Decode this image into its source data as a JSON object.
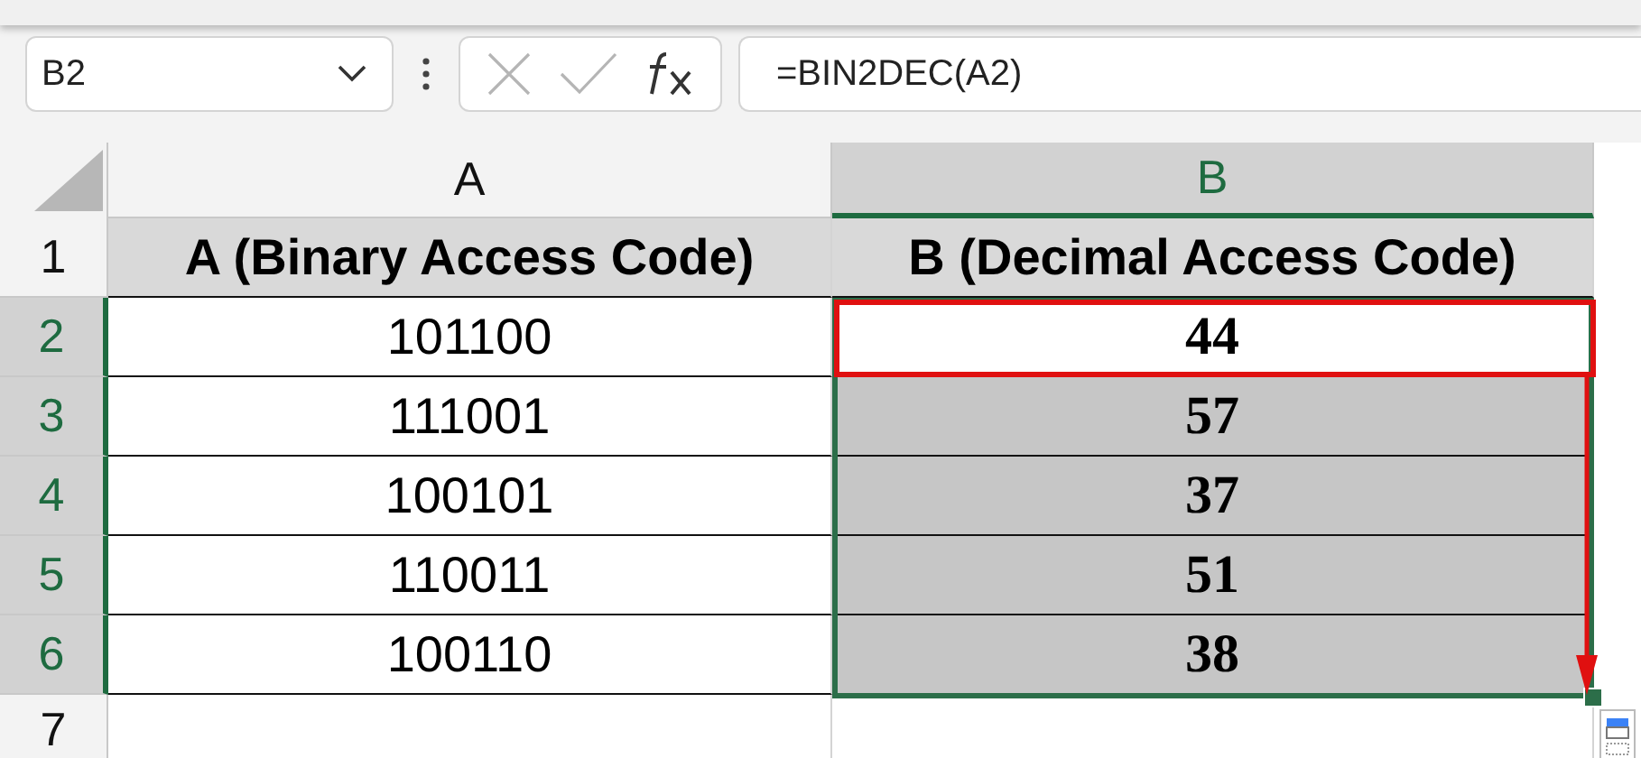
{
  "name_box": {
    "value": "B2"
  },
  "formula_bar": {
    "value": "=BIN2DEC(A2)"
  },
  "columns": [
    {
      "label": "A",
      "selected": false
    },
    {
      "label": "B",
      "selected": true
    }
  ],
  "rows": [
    {
      "number": "1",
      "selected": false,
      "cells": [
        {
          "kind": "header",
          "text": "A (Binary Access Code)",
          "selected": false
        },
        {
          "kind": "header",
          "text": "B (Decimal Access Code)",
          "selected": false
        }
      ]
    },
    {
      "number": "2",
      "selected": true,
      "cells": [
        {
          "kind": "binary",
          "text": "101100",
          "selected": false
        },
        {
          "kind": "decimal",
          "text": "44",
          "selected": false
        }
      ]
    },
    {
      "number": "3",
      "selected": true,
      "cells": [
        {
          "kind": "binary",
          "text": "111001",
          "selected": false
        },
        {
          "kind": "decimal",
          "text": "57",
          "selected": true
        }
      ]
    },
    {
      "number": "4",
      "selected": true,
      "cells": [
        {
          "kind": "binary",
          "text": "100101",
          "selected": false
        },
        {
          "kind": "decimal",
          "text": "37",
          "selected": true
        }
      ]
    },
    {
      "number": "5",
      "selected": true,
      "cells": [
        {
          "kind": "binary",
          "text": "110011",
          "selected": false
        },
        {
          "kind": "decimal",
          "text": "51",
          "selected": true
        }
      ]
    },
    {
      "number": "6",
      "selected": true,
      "cells": [
        {
          "kind": "binary",
          "text": "100110",
          "selected": false
        },
        {
          "kind": "decimal",
          "text": "38",
          "selected": true
        }
      ]
    },
    {
      "number": "7",
      "selected": false,
      "cells": []
    }
  ]
}
